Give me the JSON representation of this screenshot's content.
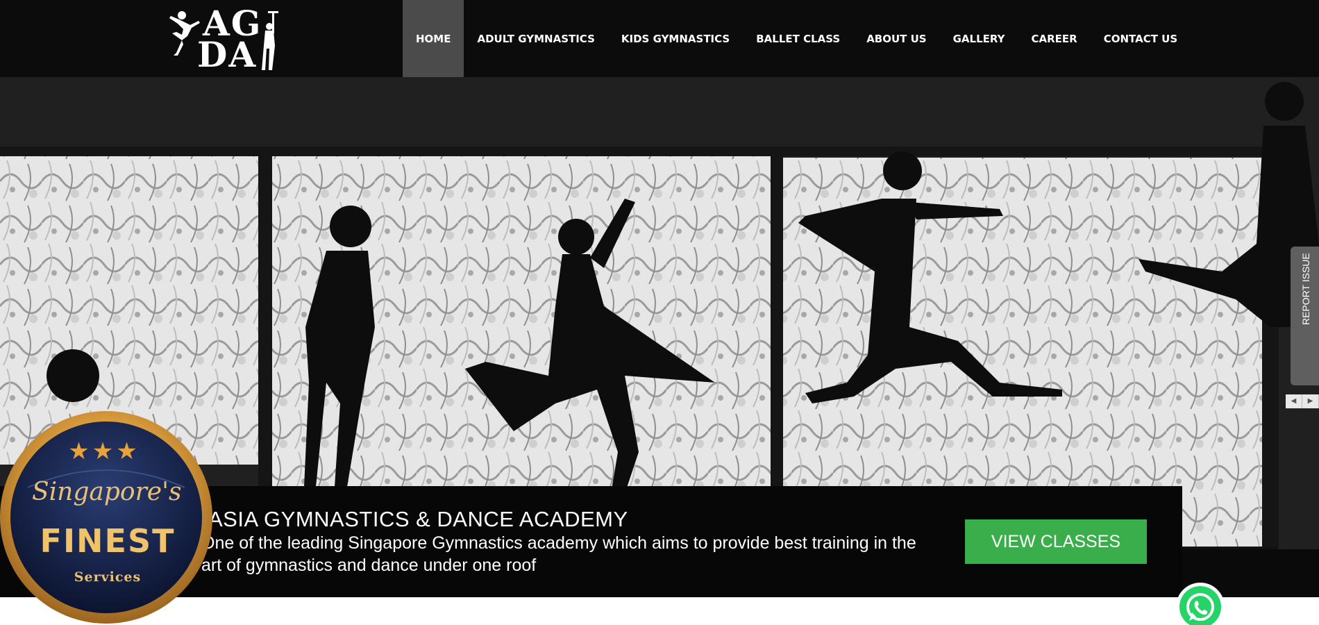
{
  "header": {
    "logo": {
      "line1": "AG",
      "line2": "DA"
    },
    "nav": [
      {
        "label": "HOME",
        "active": true
      },
      {
        "label": "ADULT GYMNASTICS"
      },
      {
        "label": "KIDS GYMNASTICS"
      },
      {
        "label": "BALLET CLASS"
      },
      {
        "label": "ABOUT US"
      },
      {
        "label": "GALLERY"
      },
      {
        "label": "CAREER"
      },
      {
        "label": "CONTACT US"
      }
    ]
  },
  "hero": {
    "title": "ASIA GYMNASTICS & DANCE ACADEMY",
    "description": "One of the leading Singapore Gymnastics academy which aims to provide best training in the art of gymnastics and dance under one roof",
    "cta_label": "VIEW CLASSES"
  },
  "report_tab": {
    "label": "REPORT ISSUE",
    "arrows": [
      "◀",
      "▶"
    ]
  },
  "badge": {
    "stars": "★★★",
    "line1": "Singapore's",
    "line2": "FINEST",
    "line3": "Services"
  },
  "colors": {
    "header_bg": "#0c0c0c",
    "nav_active_bg": "#4b4b4b",
    "cta_bg": "#3aae4a",
    "badge_gold": "#e7a23c",
    "badge_navy": "#16234a",
    "whatsapp_green": "#25d366"
  },
  "icons": [
    "whatsapp-icon",
    "star-icon",
    "chevron-left-icon",
    "chevron-right-icon"
  ]
}
